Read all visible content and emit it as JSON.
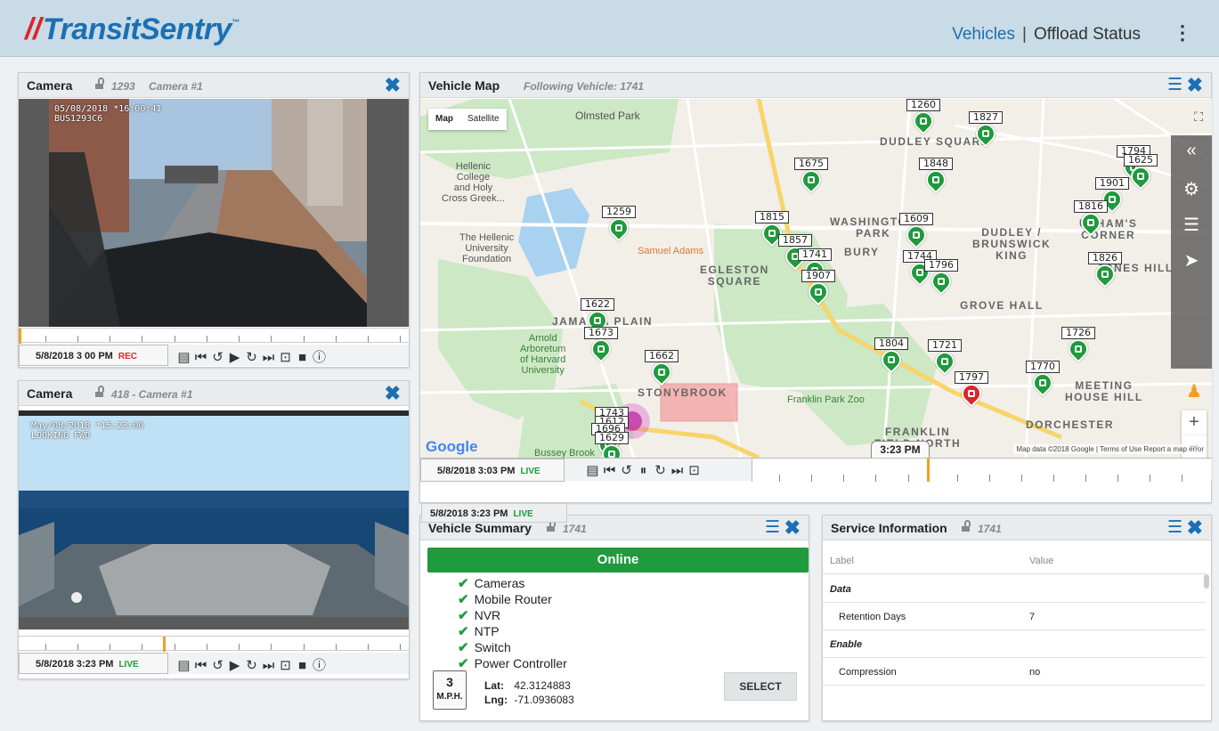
{
  "header": {
    "logo": "TransitSentry",
    "logo_tm": "™",
    "nav_vehicles": "Vehicles",
    "nav_sep": "|",
    "nav_offload": "Offload Status",
    "menu_icon": "kebab-icon"
  },
  "camera1": {
    "title": "Camera",
    "id": "1293",
    "name": "Camera #1",
    "overlay": "05/08/2018 *16:00:41\nBUS1293C6",
    "timestamp": "5/8/2018  3 00 PM",
    "status": "REC",
    "status_color": "#d9262b"
  },
  "camera2": {
    "title": "Camera",
    "id_name": "418 - Camera #1",
    "overlay": "May/08/2018 *15:23:00\nLOOKING FWD",
    "timestamp": "5/8/2018  3:23 PM",
    "status": "LIVE",
    "status_color": "#1f9a3c"
  },
  "map": {
    "title": "Vehicle Map",
    "following": "Following Vehicle: 1741",
    "type_map": "Map",
    "type_satellite": "Satellite",
    "time_label": "3:23 PM",
    "google": "Google",
    "footer": "Map data ©2018 Google | Terms of Use   Report a map error",
    "timestamp": "5/8/2018  3:03 PM",
    "status": "LIVE",
    "tooltip_timestamp": "5/8/2018  3:23 PM",
    "tooltip_status": "LIVE",
    "areas": {
      "dudley_sq": "DUDLEY SQUARE",
      "washington_park": "WASHINGTON\nPARK",
      "roxbury": "BURY",
      "dudley_brunswick": "DUDLEY /\nBRUNSWICK\nKING",
      "uphams": "UPHAM'S\nCORNER",
      "jones_hill": "JONES HILL",
      "egleston": "EGLESTON\nSQUARE",
      "grove_hall": "GROVE HALL",
      "jamaica_plain": "JAMAICA PLAIN",
      "stonybrook": "STONYBROOK",
      "meeting_house": "MEETING\nHOUSE HILL",
      "dorchester": "DORCHESTER",
      "franklin_field": "FRANKLIN\nFIELD NORTH"
    },
    "pois": {
      "olmsted": "Olmsted Park",
      "hellenic_college": "Hellenic\nCollege\nand Holy\nCross Greek...",
      "hellenic_uni": "The Hellenic\nUniversity\nFoundation",
      "samuel_adams": "Samuel Adams",
      "arnold": "Arnold\nArboretum\nof Harvard\nUniversity",
      "franklin_zoo": "Franklin Park Zoo",
      "bussey": "Bussey Brook\nMeadow"
    },
    "vehicles": [
      {
        "id": "1260",
        "color": "#1f9a3c"
      },
      {
        "id": "1827",
        "color": "#1f9a3c"
      },
      {
        "id": "1794",
        "color": "#1f9a3c"
      },
      {
        "id": "1625",
        "color": "#1f9a3c"
      },
      {
        "id": "1675",
        "color": "#1f9a3c"
      },
      {
        "id": "1848",
        "color": "#1f9a3c"
      },
      {
        "id": "1901",
        "color": "#1f9a3c"
      },
      {
        "id": "1816",
        "color": "#1f9a3c"
      },
      {
        "id": "1259",
        "color": "#1f9a3c"
      },
      {
        "id": "1815",
        "color": "#1f9a3c"
      },
      {
        "id": "1609",
        "color": "#1f9a3c"
      },
      {
        "id": "1857",
        "color": "#1f9a3c"
      },
      {
        "id": "1741",
        "color": "#1f9a3c"
      },
      {
        "id": "1744",
        "color": "#1f9a3c"
      },
      {
        "id": "1796",
        "color": "#1f9a3c"
      },
      {
        "id": "1826",
        "color": "#1f9a3c"
      },
      {
        "id": "1907",
        "color": "#1f9a3c"
      },
      {
        "id": "1622",
        "color": "#1f9a3c"
      },
      {
        "id": "1673",
        "color": "#1f9a3c"
      },
      {
        "id": "1804",
        "color": "#1f9a3c"
      },
      {
        "id": "1721",
        "color": "#1f9a3c"
      },
      {
        "id": "1726",
        "color": "#1f9a3c"
      },
      {
        "id": "1662",
        "color": "#1f9a3c"
      },
      {
        "id": "1770",
        "color": "#1f9a3c"
      },
      {
        "id": "1797",
        "color": "#d9262b"
      },
      {
        "id": "1743",
        "color": "#1f9a3c"
      },
      {
        "id": "1612",
        "color": "#1f9a3c"
      },
      {
        "id": "1696",
        "color": "#1f9a3c"
      },
      {
        "id": "1629",
        "color": "#1f9a3c"
      }
    ]
  },
  "summary": {
    "title": "Vehicle Summary",
    "id": "1741",
    "status": "Online",
    "status_color": "#1f9a3c",
    "checks": [
      "Cameras",
      "Mobile Router",
      "NVR",
      "NTP",
      "Switch",
      "Power Controller"
    ],
    "speed": "3",
    "speed_unit": "M.P.H.",
    "lat_label": "Lat:",
    "lat": "42.3124883",
    "lng_label": "Lng:",
    "lng": "-71.0936083",
    "select": "SELECT"
  },
  "service": {
    "title": "Service Information",
    "id": "1741",
    "col_label": "Label",
    "col_value": "Value",
    "rows": [
      {
        "label": "Data",
        "value": "",
        "group": true
      },
      {
        "label": "Retention Days",
        "value": "7",
        "group": false
      },
      {
        "label": "Enable",
        "value": "",
        "group": true
      },
      {
        "label": "Compression",
        "value": "no",
        "group": false
      }
    ]
  }
}
